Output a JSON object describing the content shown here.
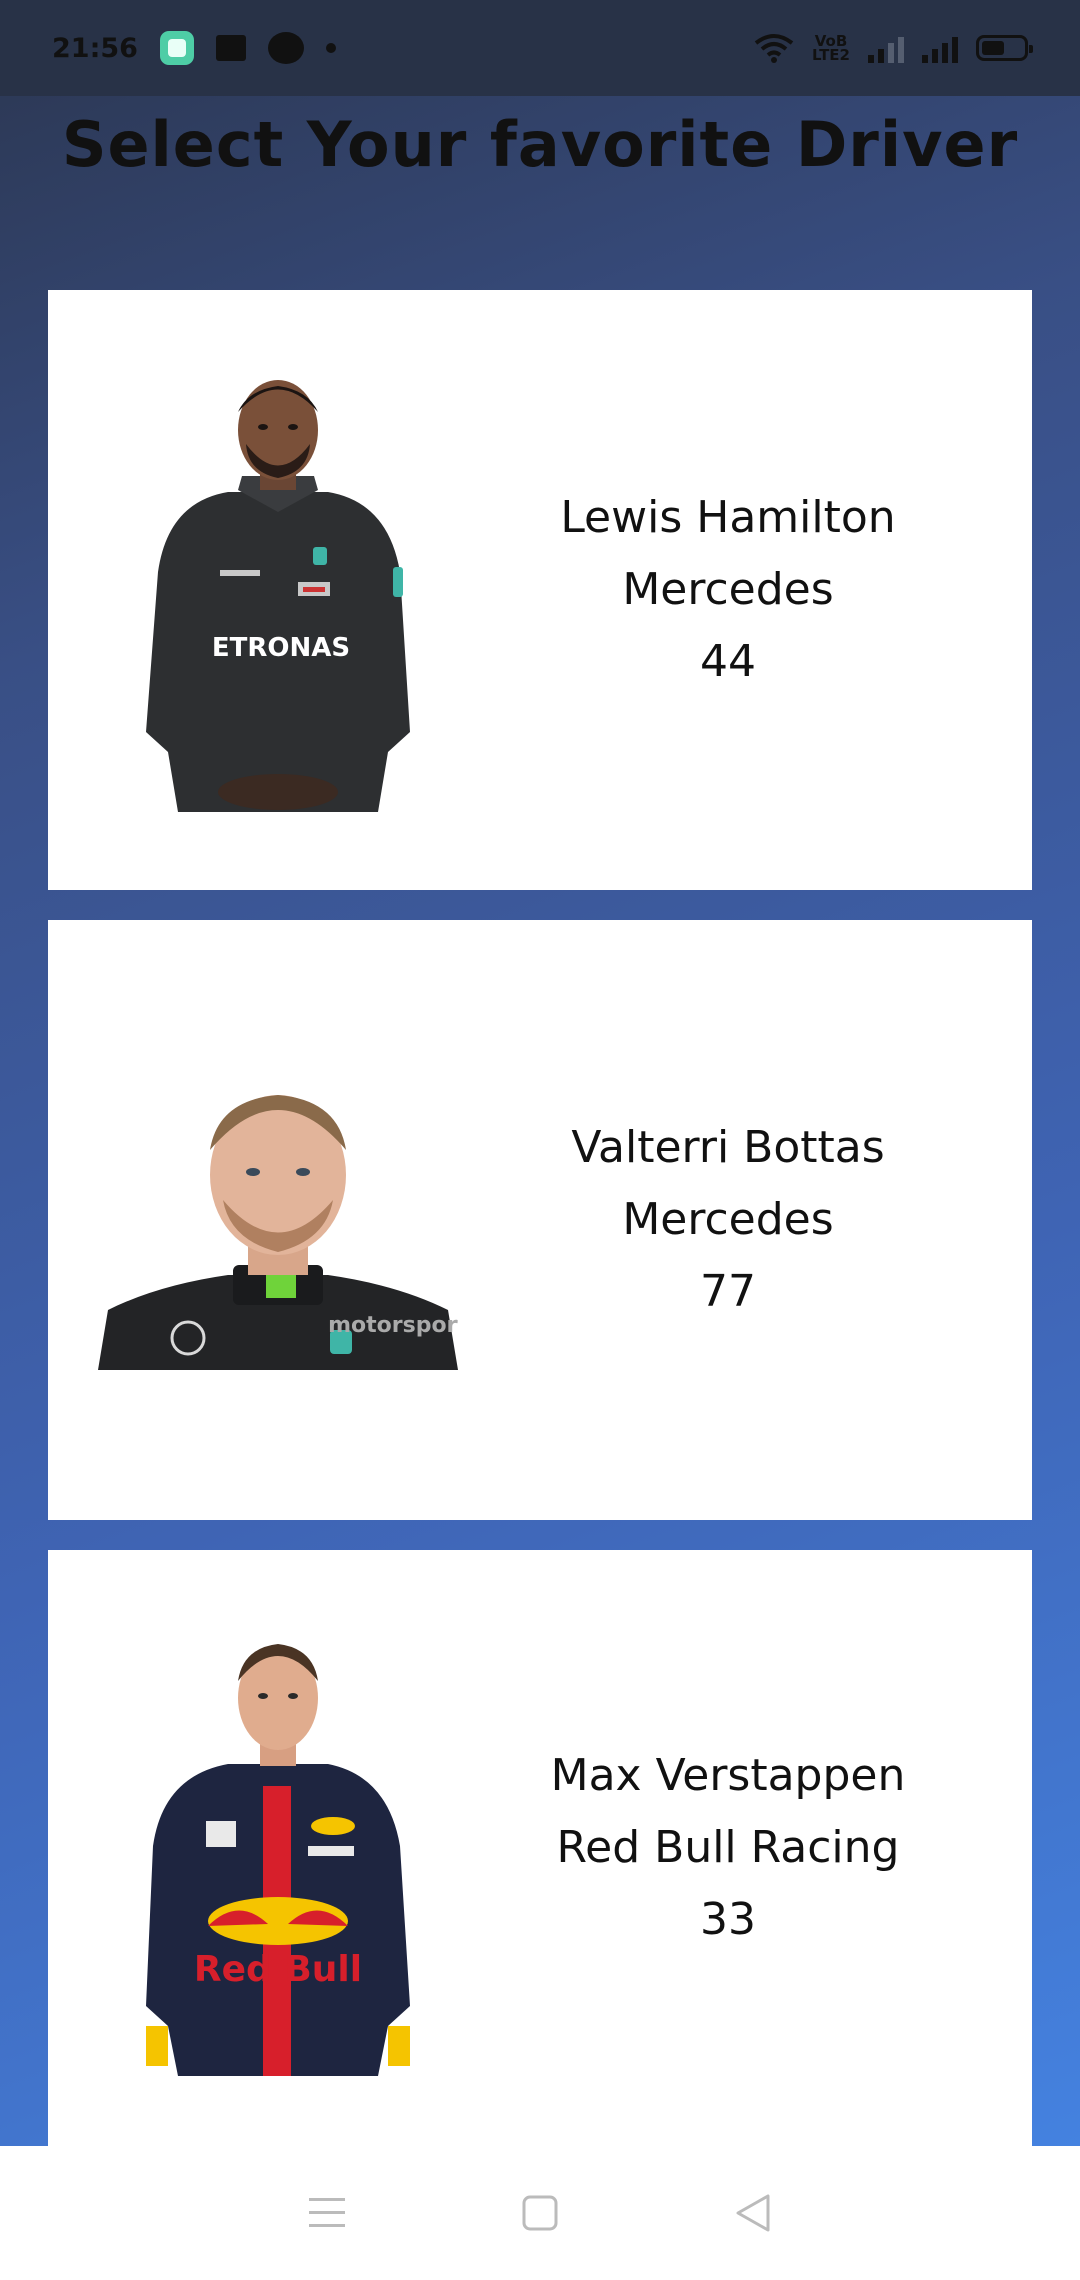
{
  "status_bar": {
    "time": "21:56",
    "network_label_top": "VoB",
    "network_label_bottom": "LTE2"
  },
  "page": {
    "title": "Select Your favorite Driver"
  },
  "drivers": [
    {
      "name": "Lewis Hamilton",
      "team": "Mercedes",
      "number": "44"
    },
    {
      "name": "Valterri Bottas",
      "team": "Mercedes",
      "number": "77"
    },
    {
      "name": "Max Verstappen",
      "team": "Red Bull Racing",
      "number": "33"
    }
  ],
  "colors": {
    "status_bar_bg": "#283247",
    "gradient_top": "#2b3650",
    "gradient_bottom": "#4586e6",
    "card_bg": "#ffffff",
    "mercedes_suit": "#2d2f31",
    "redbull_suit": "#1e2540",
    "redbull_red": "#d71f2b",
    "redbull_yellow": "#f5c400"
  },
  "icons": {
    "status_left": [
      "app-notification-icon",
      "film-icon",
      "chat-icon",
      "dot-icon"
    ],
    "status_right": [
      "wifi-icon",
      "volte-icon",
      "signal-icon",
      "signal-icon",
      "battery-icon"
    ],
    "nav": [
      "menu-icon",
      "home-square-icon",
      "back-triangle-icon"
    ]
  }
}
